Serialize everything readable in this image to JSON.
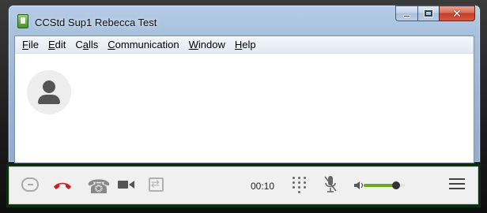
{
  "window": {
    "title": "CCStd Sup1 Rebecca Test",
    "controls": {
      "minimize": "minimize",
      "maximize": "maximize",
      "close": "✕"
    }
  },
  "menubar": {
    "items": [
      {
        "accel": "F",
        "rest": "ile"
      },
      {
        "accel": "E",
        "rest": "dit"
      },
      {
        "pre": "C",
        "accel": "a",
        "rest": "lls"
      },
      {
        "accel": "C",
        "rest": "ommunication"
      },
      {
        "accel": "W",
        "rest": "indow"
      },
      {
        "accel": "H",
        "rest": "elp"
      }
    ]
  },
  "contact": {
    "avatar_icon": "user-silhouette-icon"
  },
  "toolbar": {
    "icons": [
      "chat-icon",
      "hangup-icon",
      "phone-icon",
      "video-icon",
      "transfer-icon",
      "dialpad-icon",
      "mute-icon",
      "volume-icon",
      "hamburger-menu-icon"
    ],
    "phone_glyph": "☎",
    "transfer_glyph": "⇄",
    "call_timer": "00:10",
    "volume_level": 0.78,
    "colors": {
      "hangup": "#cc1f1f",
      "volume_fill": "#69a825",
      "frame": "#0d3b12"
    }
  }
}
